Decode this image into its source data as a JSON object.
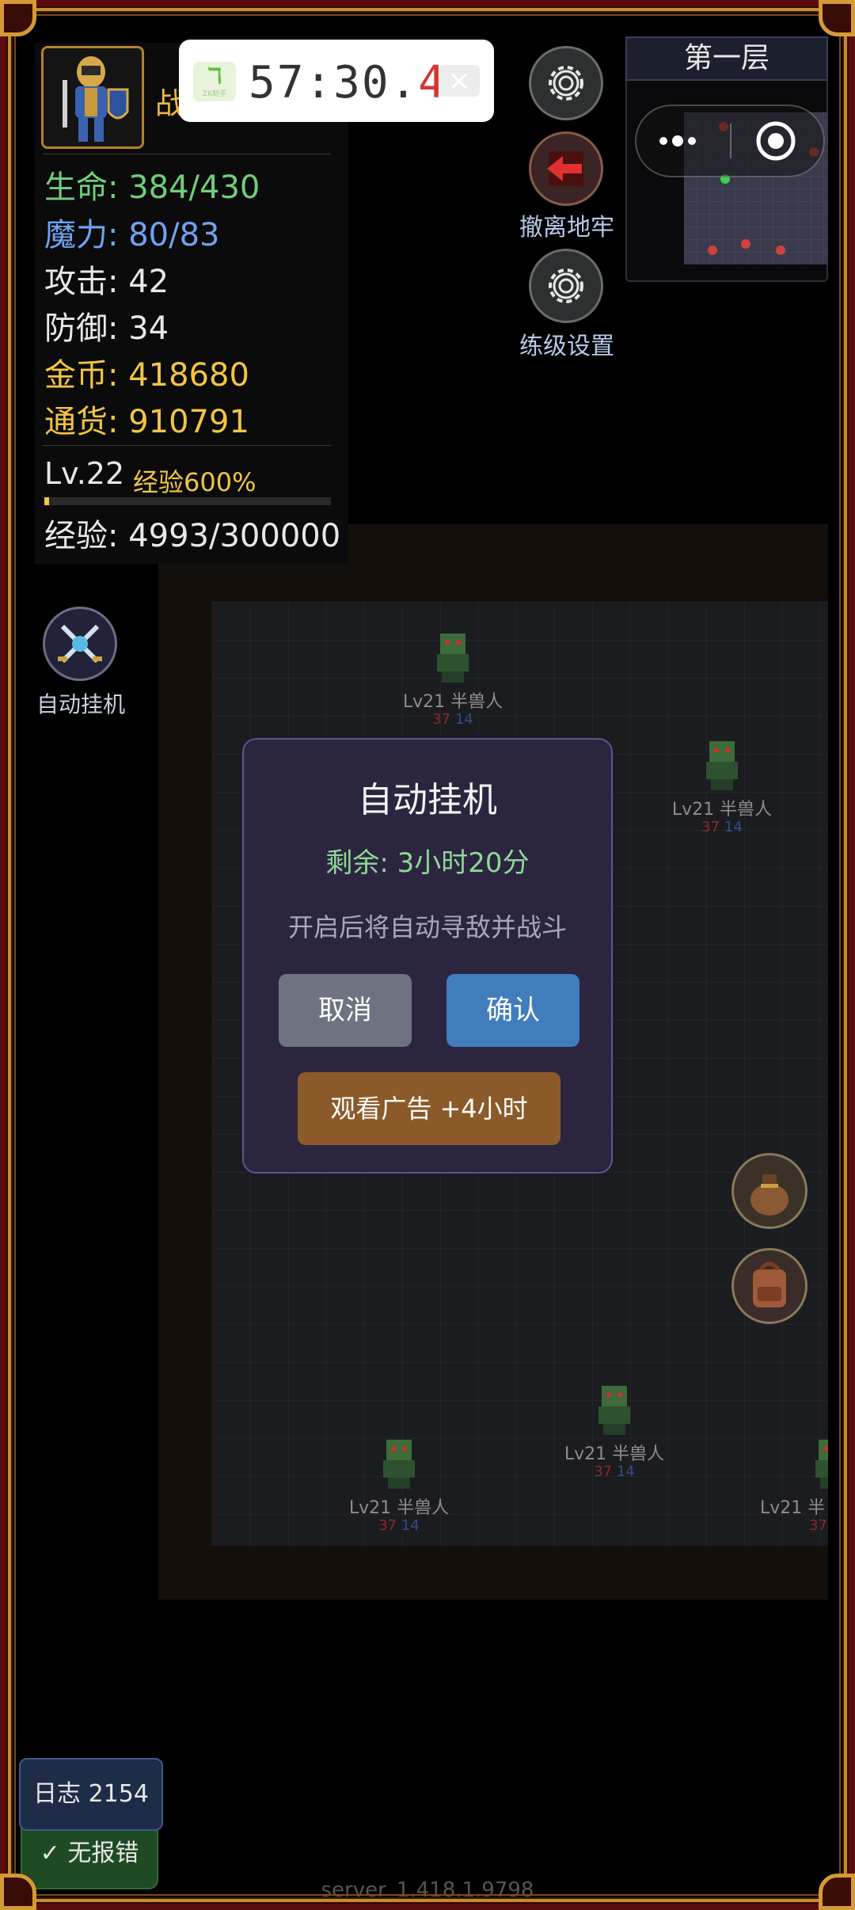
{
  "hero": {
    "name_partial": "战",
    "hp_label": "生命:",
    "hp_value": "384/430",
    "mp_label": "魔力:",
    "mp_value": "80/83",
    "atk_label": "攻击:",
    "atk_value": "42",
    "def_label": "防御:",
    "def_value": "34",
    "gold_label": "金币:",
    "gold_value": "418680",
    "currency_label": "通货:",
    "currency_value": "910791",
    "level": "Lv.22",
    "exp_bonus": "经验600%",
    "exp_label": "经验:",
    "exp_value": "4993/300000",
    "exp_progress": 0.017
  },
  "timer": {
    "logo_text": "ZK助手",
    "time_main": "57:30.",
    "time_tenth": "4",
    "close_icon": "close-icon"
  },
  "right_buttons": {
    "exit_label": "撤离地牢",
    "training_label": "练级设置"
  },
  "floor": {
    "title": "第一层"
  },
  "auto": {
    "label": "自动挂机"
  },
  "monsters": [
    {
      "name": "Lv21 半兽人",
      "atk": "37",
      "def": "14"
    },
    {
      "name": "Lv21 半兽人",
      "atk": "37",
      "def": "14"
    },
    {
      "name": "Lv21 半兽人",
      "atk": "37",
      "def": "14"
    },
    {
      "name": "Lv21 半兽人",
      "atk": "37",
      "def": "14"
    },
    {
      "name": "Lv21 半",
      "atk": "37",
      "def": ""
    }
  ],
  "dialog": {
    "title": "自动挂机",
    "remaining": "剩余: 3小时20分",
    "description": "开启后将自动寻敌并战斗",
    "cancel": "取消",
    "confirm": "确认",
    "watch_ad": "观看广告 +4小时"
  },
  "bottom": {
    "log": "日志 2154",
    "no_error": "无报错",
    "server": "server_1.418.1.9798"
  },
  "colors": {
    "hp": "#6fd07a",
    "mp": "#6fa3f2",
    "gold": "#f2c544",
    "confirm": "#3f7dbd",
    "ad": "#8c5a28",
    "dialog_bg": "#2b2540"
  }
}
